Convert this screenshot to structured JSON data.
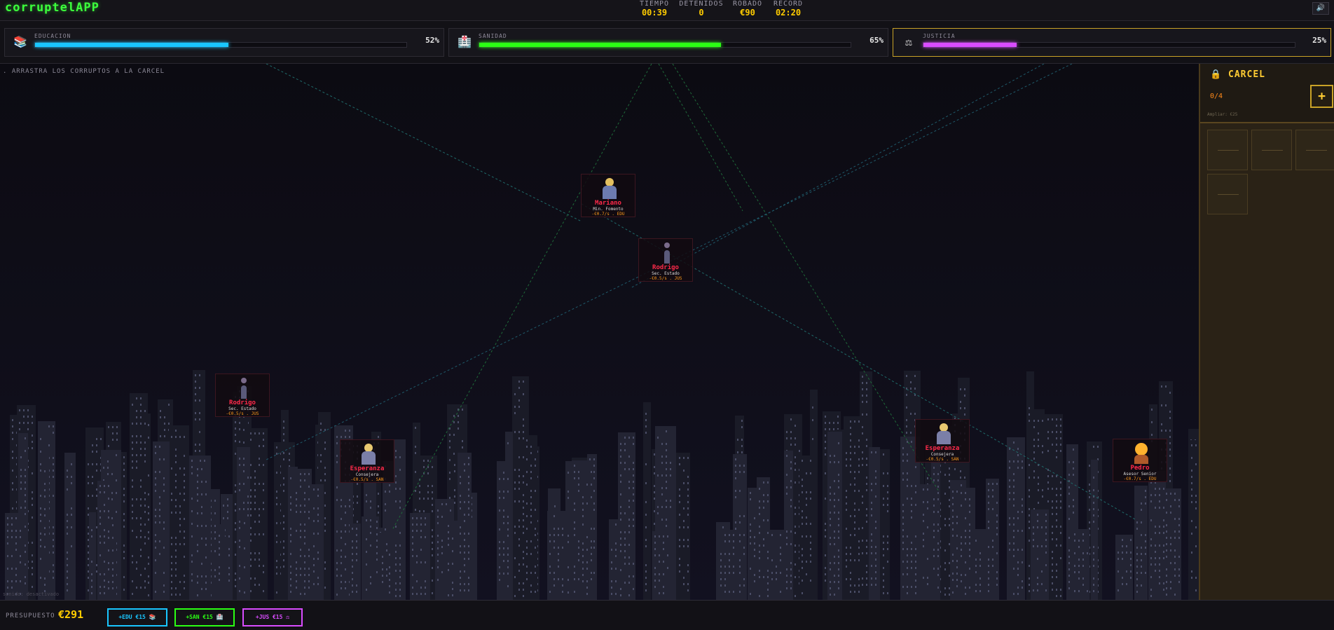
{
  "header": {
    "logo": "corruptelAPP",
    "stats": [
      {
        "label": "TIEMPO",
        "value": "00:39"
      },
      {
        "label": "DETENIDOS",
        "value": "0"
      },
      {
        "label": "ROBADO",
        "value": "€90"
      },
      {
        "label": "RECORD",
        "value": "02:20"
      }
    ],
    "mute_icon": "speaker-icon",
    "mute_label": "🔊"
  },
  "meters": [
    {
      "name": "EDUCACION",
      "icon": "books-icon",
      "glyph": "📚",
      "percent_label": "52%",
      "fill": 0.52,
      "color": "#19c6ff"
    },
    {
      "name": "SANIDAD",
      "icon": "hospital-icon",
      "glyph": "🏥",
      "percent_label": "65%",
      "fill": 0.65,
      "color": "#2bff14"
    },
    {
      "name": "JUSTICIA",
      "icon": "scales-icon",
      "glyph": "⚖",
      "percent_label": "25%",
      "fill": 0.25,
      "color": "#d94cff"
    }
  ],
  "field": {
    "hint": ". ARRASTRA LOS CORRUPTOS A LA CARCEL",
    "status": "sonido: desactivado",
    "corrupts": [
      {
        "name": "Mariano",
        "role": "Min. Fomento",
        "rate": "-€0.7/s . EDU"
      },
      {
        "name": "Rodrigo",
        "role": "Sec. Estado",
        "rate": "-€0.5/s . JUS"
      },
      {
        "name": "Rodrigo",
        "role": "Sec. Estado",
        "rate": "-€0.5/s . JUS"
      },
      {
        "name": "Esperanza",
        "role": "Consejera",
        "rate": "-€0.5/s . SAN"
      },
      {
        "name": "Esperanza",
        "role": "Consejera",
        "rate": "-€0.5/s . SAN"
      },
      {
        "name": "Pedro",
        "role": "Asesor Senior",
        "rate": "-€0.7/s . EDU"
      }
    ]
  },
  "jail": {
    "title": "CARCEL",
    "lock_icon": "lock-icon",
    "capacity": "0/4",
    "expand_label": "Ampliar: €25",
    "plus_label": "+"
  },
  "footer": {
    "budget_label": "PRESUPUESTO",
    "budget_value": "€291",
    "buttons": [
      {
        "label": "+EDU €15",
        "glyph": "📚",
        "color": "#19c6ff"
      },
      {
        "label": "+SAN €15",
        "glyph": "🏥",
        "color": "#2bff14"
      },
      {
        "label": "+JUS €15",
        "glyph": "⚖",
        "color": "#d94cff"
      }
    ]
  },
  "colors": {
    "accent_gold": "#ffcc00",
    "logo_green": "#3cff3c",
    "name_red": "#ff2a4a"
  }
}
